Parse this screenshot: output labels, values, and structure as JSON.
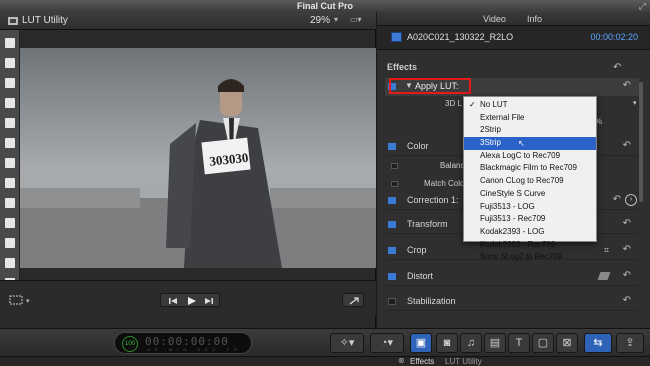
{
  "app": {
    "title": "Final Cut Pro"
  },
  "viewer": {
    "title": "LUT Utility",
    "zoom": "29%",
    "photo_bib_number": "303030"
  },
  "inspector": {
    "tabs": [
      "Video",
      "Info"
    ],
    "clip_name": "A020C021_130322_R2LO",
    "clip_timecode": "00:00:02:20",
    "effects_label": "Effects",
    "apply_lut_label": "Apply LUT:",
    "lut_param_label": "3D L",
    "lut_param2_label": "M",
    "lut_param2_value": "%",
    "color_label": "Color",
    "balance_label": "Balanc",
    "match_color_label": "Match Colo",
    "correction_label": "Correction 1:",
    "transform_label": "Transform",
    "crop_label": "Crop",
    "distort_label": "Distort",
    "stabilization_label": "Stabilization"
  },
  "lut_menu": {
    "items": [
      "No LUT",
      "External File",
      "2Strip",
      "3Strip",
      "Alexa LogC to Rec709",
      "Blackmagic Film to Rec709",
      "Canon CLog to Rec709",
      "CineStyle S Curve",
      "Fuji3513 - LOG",
      "Fuji3513 - Rec709",
      "Kodak2393 - LOG",
      "Kodak2393 - Rec709",
      "Sony SLog2 to Rec709"
    ],
    "checked": "No LUT",
    "highlighted": "3Strip"
  },
  "toolbar": {
    "timecode_badge": "100",
    "timecode_digits": "00:00:00:00",
    "timecode_units": "HR MIN SEC FR"
  },
  "bottom": {
    "effects_label": "Effects",
    "lut_label": "LUT Utility"
  },
  "colors": {
    "accent_blue": "#2f63b7",
    "highlight_red": "#e11a1a",
    "timecode_blue": "#5aa5ff"
  }
}
